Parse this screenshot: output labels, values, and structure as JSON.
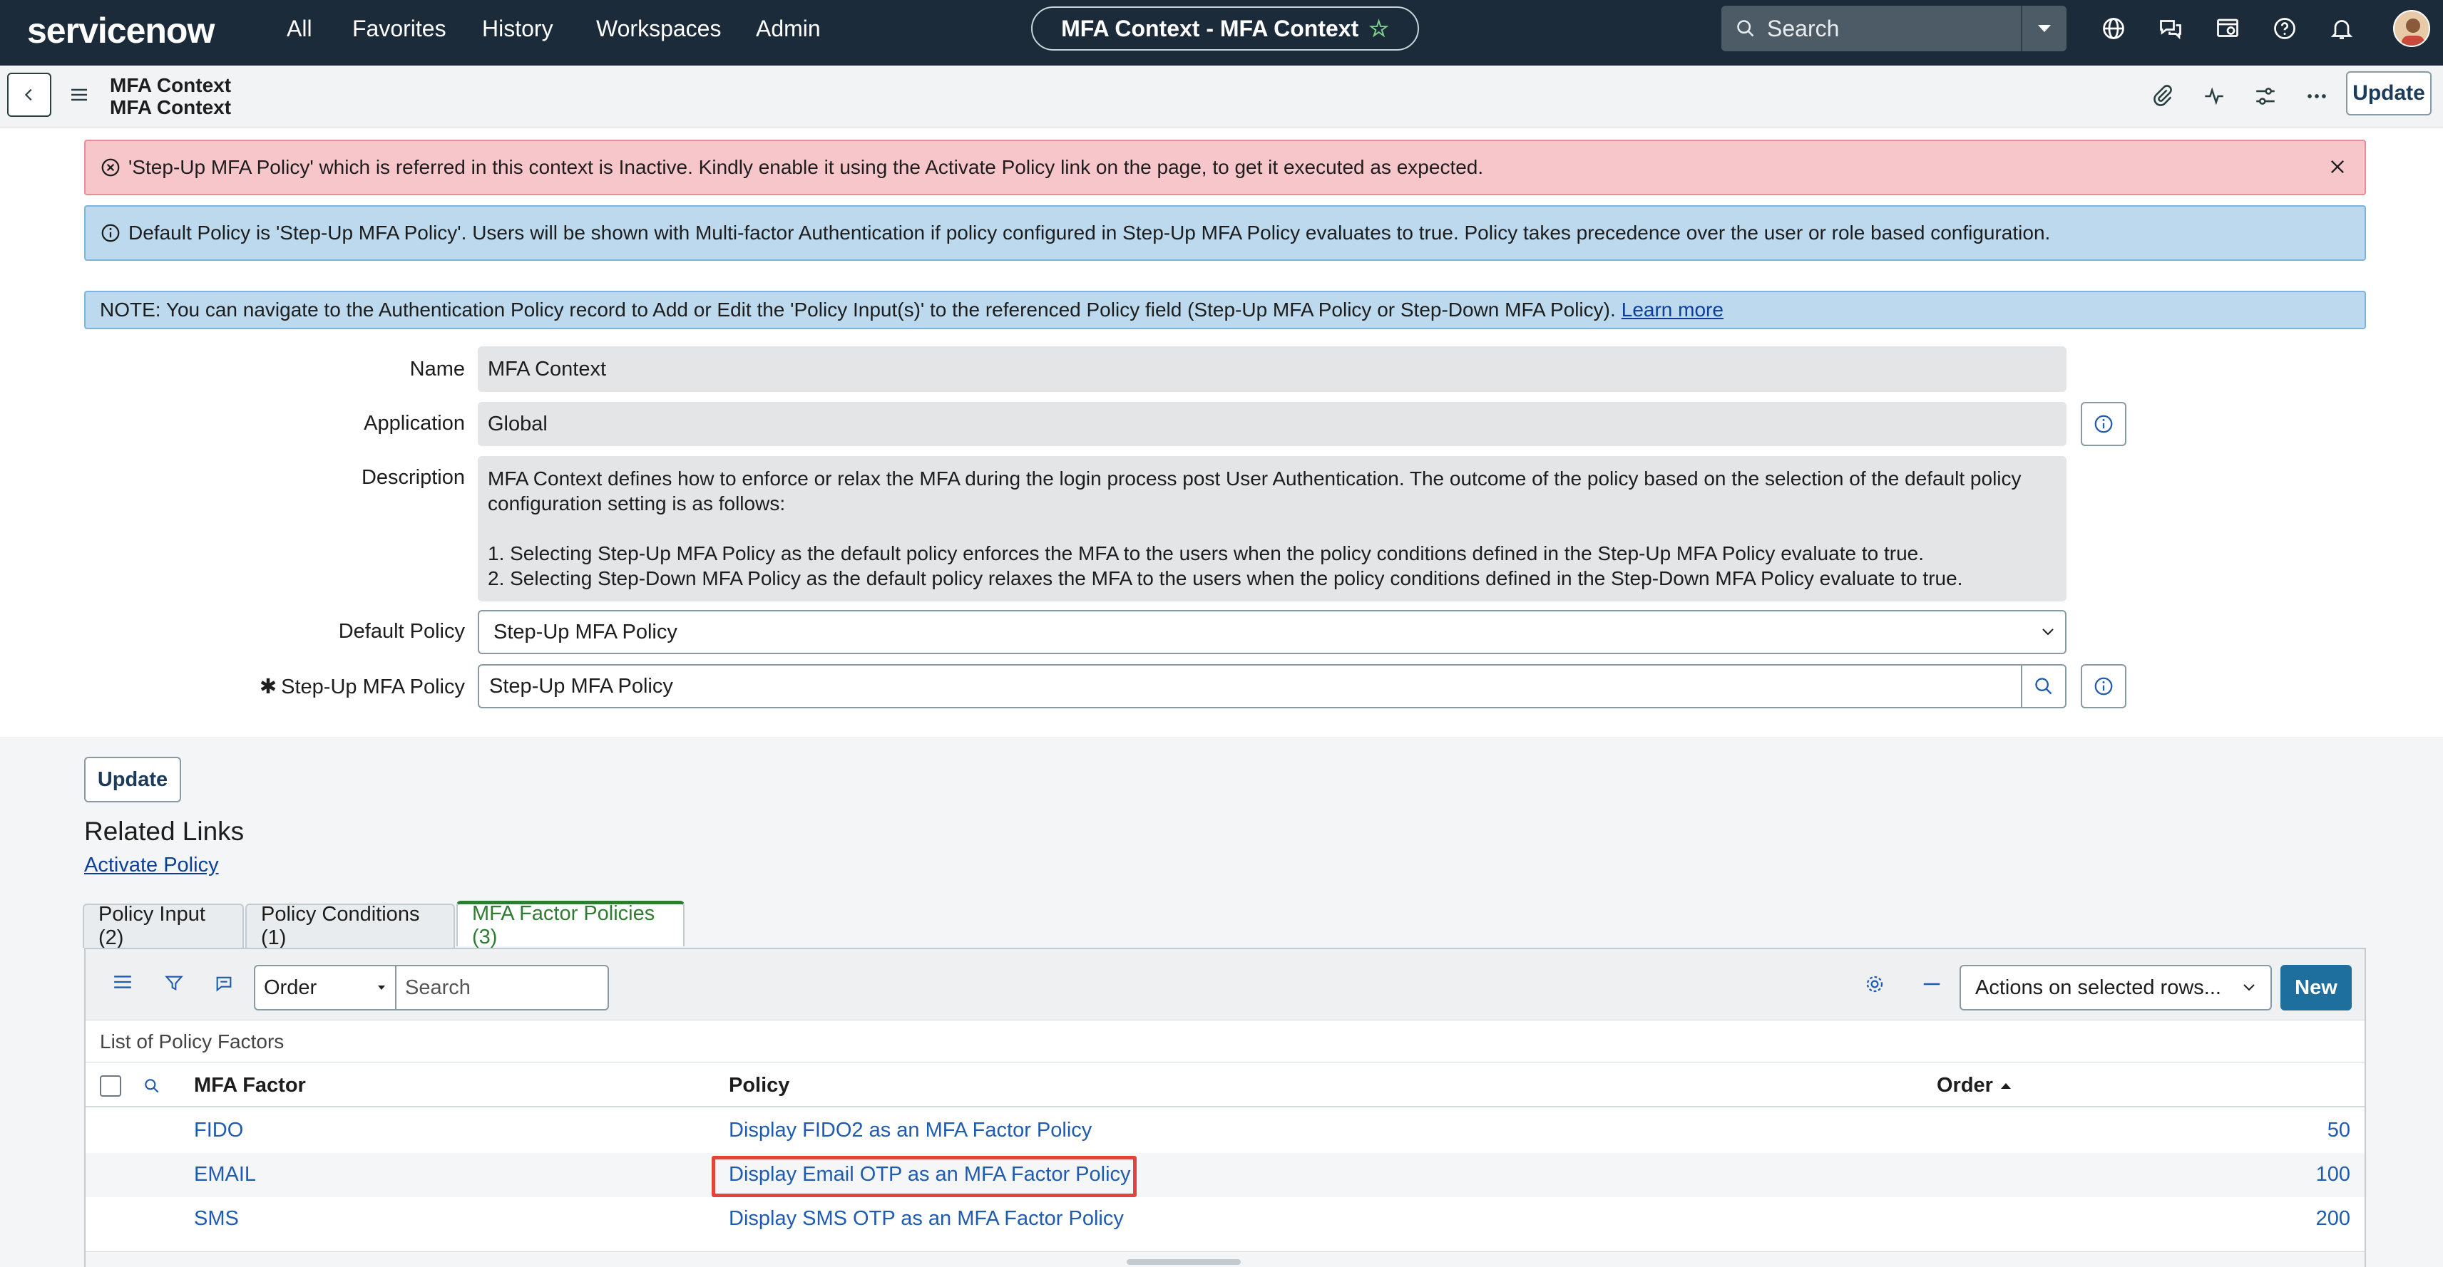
{
  "topnav": {
    "logo": "servicenow",
    "items": [
      "All",
      "Favorites",
      "History",
      "Workspaces",
      "Admin"
    ],
    "context_title": "MFA Context - MFA Context",
    "search_placeholder": "Search"
  },
  "subheader": {
    "title_line1": "MFA Context",
    "title_line2": "MFA Context",
    "update_label": "Update"
  },
  "alerts": {
    "error": "'Step-Up MFA Policy' which is referred in this context is Inactive. Kindly enable it using the Activate Policy link on the page, to get it executed as expected.",
    "info": "Default Policy is 'Step-Up MFA Policy'. Users will be shown with Multi-factor Authentication if policy configured in Step-Up MFA Policy evaluates to true. Policy takes precedence over the user or role based configuration.",
    "note": "NOTE: You can navigate to the Authentication Policy record to Add or Edit the 'Policy Input(s)' to the referenced Policy field (Step-Up MFA Policy or Step-Down MFA Policy).",
    "note_link": "Learn more"
  },
  "form": {
    "name_label": "Name",
    "name_value": "MFA Context",
    "application_label": "Application",
    "application_value": "Global",
    "description_label": "Description",
    "description_p1": "MFA Context defines how to enforce or relax the MFA during the login process post User Authentication. The outcome of the policy based on the selection of the default policy configuration setting is as follows:",
    "description_p2": "1. Selecting Step-Up MFA Policy as the default policy enforces the MFA to the users when the policy conditions defined in the Step-Up MFA Policy evaluate to true.",
    "description_p3": "2. Selecting Step-Down MFA Policy as the default policy relaxes the MFA to the users when the policy conditions defined in the Step-Down MFA Policy evaluate to true.",
    "default_policy_label": "Default Policy",
    "default_policy_value": "Step-Up MFA Policy",
    "stepup_label": "Step-Up MFA Policy",
    "stepup_value": "Step-Up MFA Policy"
  },
  "bottom": {
    "update_label": "Update",
    "related_title": "Related Links",
    "related_link": "Activate Policy"
  },
  "tabs": [
    {
      "label": "Policy Input (2)"
    },
    {
      "label": "Policy Conditions (1)"
    },
    {
      "label": "MFA Factor Policies (3)"
    }
  ],
  "list": {
    "order_select": "Order",
    "search_placeholder": "Search",
    "actions_select": "Actions on selected rows...",
    "new_label": "New",
    "caption": "List of Policy Factors",
    "columns": [
      "MFA Factor",
      "Policy",
      "Order"
    ],
    "rows": [
      {
        "factor": "FIDO",
        "policy": "Display FIDO2 as an MFA Factor Policy",
        "order": "50"
      },
      {
        "factor": "EMAIL",
        "policy": "Display Email OTP as an MFA Factor Policy",
        "order": "100"
      },
      {
        "factor": "SMS",
        "policy": "Display SMS OTP as an MFA Factor Policy",
        "order": "200"
      }
    ]
  },
  "colors": {
    "nav_bg": "#1c2b3a",
    "error_bg": "#f7c6cb",
    "info_bg": "#bcd9ee",
    "link": "#1f5bb0",
    "new_button": "#1f6f9e",
    "active_tab": "#2e7d32",
    "highlight": "#e0443c"
  }
}
